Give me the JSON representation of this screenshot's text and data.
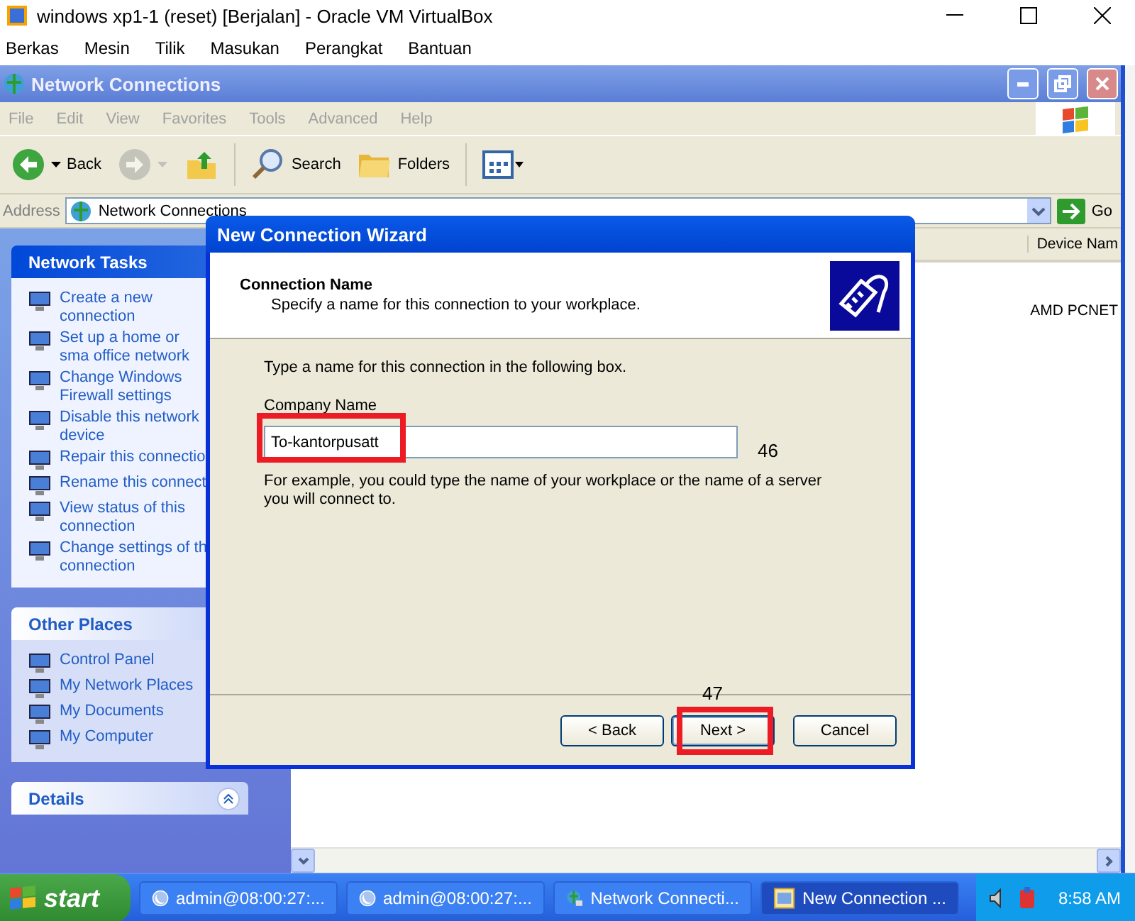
{
  "host_window": {
    "title": "windows xp1-1 (reset) [Berjalan] - Oracle VM VirtualBox",
    "menu": [
      "Berkas",
      "Mesin",
      "Tilik",
      "Masukan",
      "Perangkat",
      "Bantuan"
    ]
  },
  "explorer": {
    "title": "Network Connections",
    "menu": [
      "File",
      "Edit",
      "View",
      "Favorites",
      "Tools",
      "Advanced",
      "Help"
    ],
    "toolbar": [
      {
        "kind": "back",
        "label": "Back",
        "disabled": false
      },
      {
        "kind": "forward",
        "disabled": true
      },
      {
        "kind": "up",
        "disabled": false
      },
      {
        "kind": "search",
        "label": "Search",
        "disabled": false
      },
      {
        "kind": "folders",
        "label": "Folders",
        "disabled": false
      },
      {
        "kind": "views",
        "disabled": false
      }
    ],
    "address": {
      "label": "Address",
      "value": "Network Connections",
      "go": "Go"
    },
    "sidebar": [
      {
        "title": "Network Tasks",
        "kind": "primary",
        "items": [
          "Create a new connection",
          "Set up a home or sma office network",
          "Change Windows Firewall settings",
          "Disable this network device",
          "Repair this connectio",
          "Rename this connect",
          "View status of this connection",
          "Change settings of th connection"
        ]
      },
      {
        "title": "Other Places",
        "kind": "normal",
        "items": [
          "Control Panel",
          "My Network Places",
          "My Documents",
          "My Computer"
        ]
      },
      {
        "title": "Details",
        "kind": "collapsible"
      }
    ],
    "list": {
      "columns": [
        "Device Nam"
      ],
      "rows": [
        [
          "AMD PCNET"
        ]
      ]
    }
  },
  "wizard": {
    "title": "New Connection Wizard",
    "heading": "Connection Name",
    "subheading": "Specify a name for this connection to your workplace.",
    "instruction": "Type a name for this connection in the following box.",
    "field": {
      "label": "Company Name",
      "value": "To-kantorpusatt"
    },
    "example": "For example, you could type the name of your workplace or the name of a server you will connect to.",
    "buttons": [
      {
        "label": "< Back",
        "kind": "back"
      },
      {
        "label": "Next >",
        "kind": "next"
      },
      {
        "label": "Cancel",
        "kind": "cancel"
      }
    ]
  },
  "annotations": [
    {
      "label": "46"
    },
    {
      "label": "47"
    }
  ],
  "taskbar": {
    "start": "start",
    "tasks": [
      {
        "label": "admin@08:00:27:...",
        "kind": "terminal",
        "selected": false
      },
      {
        "label": "admin@08:00:27:...",
        "kind": "terminal",
        "selected": false
      },
      {
        "label": "Network Connecti...",
        "kind": "network",
        "selected": false
      },
      {
        "label": "New Connection ...",
        "kind": "wizard",
        "selected": true
      }
    ],
    "clock": "8:58 AM"
  }
}
